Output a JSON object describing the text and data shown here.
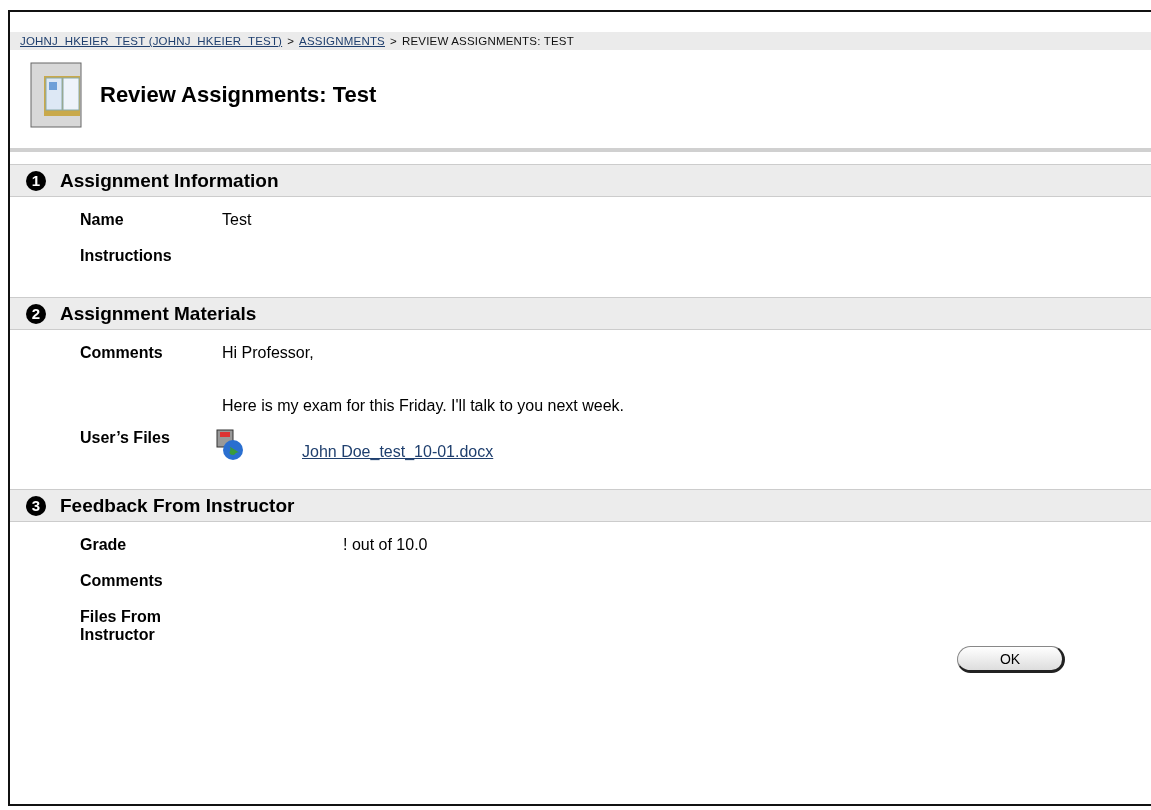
{
  "breadcrumb": [
    {
      "label": "JOHNJ_HKEIER_TEST (JOHNJ_HKEIER_TEST)",
      "kind": "link"
    },
    {
      "label": ">",
      "kind": "separator"
    },
    {
      "label": "ASSIGNMENTS",
      "kind": "link"
    },
    {
      "label": ">",
      "kind": "separator"
    },
    {
      "label": "REVIEW ASSIGNMENTS: TEST",
      "kind": "current"
    }
  ],
  "page_title": "Review Assignments: Test",
  "sections": [
    {
      "number": "1",
      "title": "Assignment Information",
      "rows": [
        {
          "kind": "text",
          "label": "Name",
          "lines": [
            "Test"
          ]
        },
        {
          "kind": "text",
          "label": "Instructions",
          "lines": []
        }
      ]
    },
    {
      "number": "2",
      "title": "Assignment Materials",
      "rows": [
        {
          "kind": "text",
          "label": "Comments",
          "lines": [
            "Hi Professor,",
            "Here is my exam for this Friday. I'll talk to you next week."
          ]
        },
        {
          "kind": "file",
          "label": "User’s Files",
          "file": "John Doe_test_10-01.docx"
        }
      ]
    },
    {
      "number": "3",
      "title": "Feedback From Instructor",
      "rows": [
        {
          "kind": "grade",
          "label": "Grade",
          "lines": [
            "! out of 10.0"
          ]
        },
        {
          "kind": "text",
          "label": "Comments",
          "lines": []
        },
        {
          "kind": "text",
          "label": "Files From Instructor",
          "lines": []
        }
      ]
    }
  ],
  "buttons": [
    "OK"
  ]
}
